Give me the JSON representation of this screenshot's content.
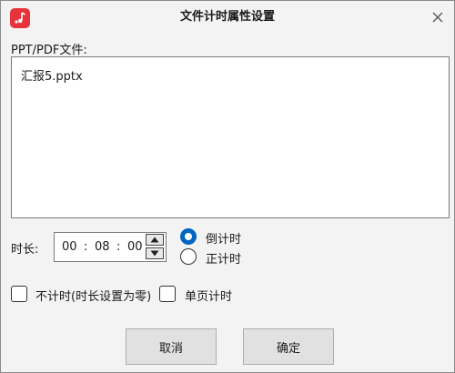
{
  "window": {
    "title": "文件计时属性设置",
    "app_icon": "music-note-icon",
    "close_icon": "close-icon",
    "accent_color": "#e8333a"
  },
  "file": {
    "label": "PPT/PDF文件:",
    "items": [
      "汇报5.pptx"
    ]
  },
  "duration": {
    "label": "时长:",
    "hours": "00",
    "minutes": "08",
    "seconds": "00",
    "separator": ":"
  },
  "mode": {
    "countdown_label": "倒计时",
    "countup_label": "正计时",
    "selected": "countdown",
    "selected_color": "#0067c0"
  },
  "options": {
    "no_timing_label": "不计时(时长设置为零)",
    "no_timing_checked": false,
    "per_page_label": "单页计时",
    "per_page_checked": false
  },
  "buttons": {
    "cancel_label": "取消",
    "ok_label": "确定"
  }
}
